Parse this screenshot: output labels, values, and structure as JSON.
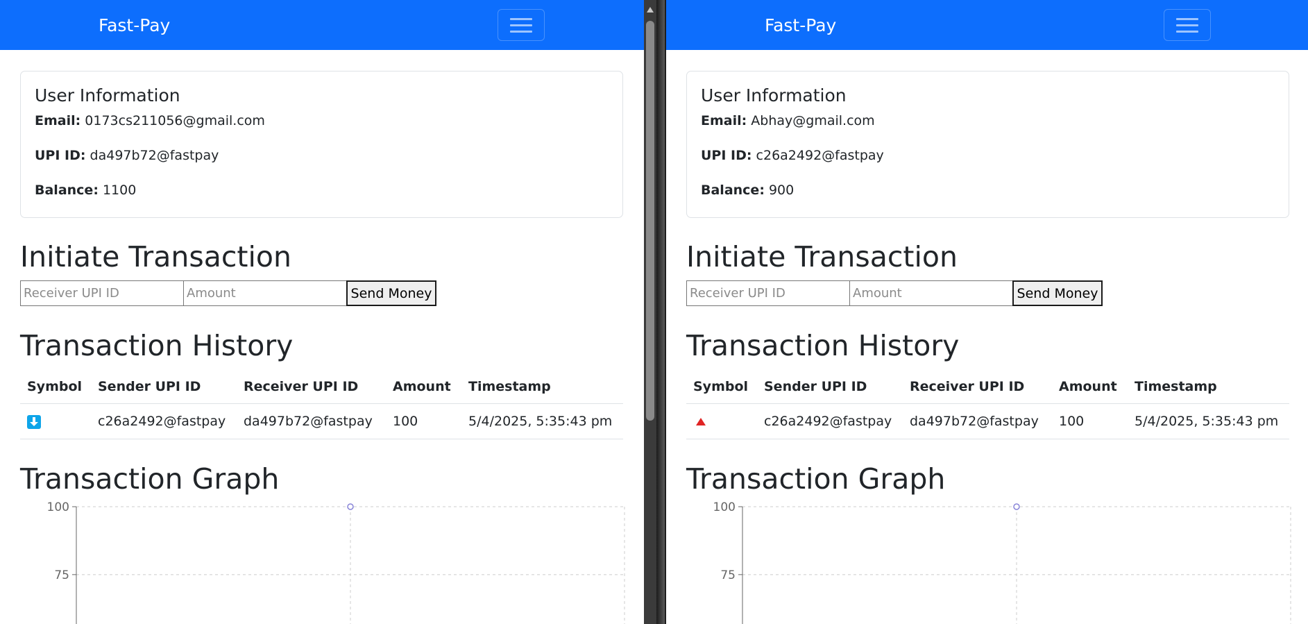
{
  "windows": [
    {
      "brand": "Fast-Pay",
      "card_title": "User Information",
      "email_label": "Email:",
      "email": "0173cs211056@gmail.com",
      "upi_label": "UPI ID:",
      "upi": "da497b72@fastpay",
      "balance_label": "Balance:",
      "balance": "1100",
      "initiate_heading": "Initiate Transaction",
      "receiver_placeholder": "Receiver UPI ID",
      "amount_placeholder": "Amount",
      "send_label": "Send Money",
      "history_heading": "Transaction History",
      "columns": [
        "Symbol",
        "Sender UPI ID",
        "Receiver UPI ID",
        "Amount",
        "Timestamp"
      ],
      "rows": [
        {
          "symbol": "received-arrow-icon",
          "sender": "c26a2492@fastpay",
          "receiver": "da497b72@fastpay",
          "amount": "100",
          "timestamp": "5/4/2025, 5:35:43 pm"
        }
      ],
      "graph_heading": "Transaction Graph",
      "chart_data": {
        "type": "line",
        "y_ticks": [
          "100",
          "75"
        ],
        "ylim_visible": [
          62,
          100
        ],
        "points": [
          {
            "x_index": 1,
            "y": 100
          }
        ],
        "x_count": 3,
        "point_color": "#8884d8",
        "grid": true
      }
    },
    {
      "brand": "Fast-Pay",
      "card_title": "User Information",
      "email_label": "Email:",
      "email": "Abhay@gmail.com",
      "upi_label": "UPI ID:",
      "upi": "c26a2492@fastpay",
      "balance_label": "Balance:",
      "balance": "900",
      "initiate_heading": "Initiate Transaction",
      "receiver_placeholder": "Receiver UPI ID",
      "amount_placeholder": "Amount",
      "send_label": "Send Money",
      "history_heading": "Transaction History",
      "columns": [
        "Symbol",
        "Sender UPI ID",
        "Receiver UPI ID",
        "Amount",
        "Timestamp"
      ],
      "rows": [
        {
          "symbol": "sent-triangle-icon",
          "sender": "c26a2492@fastpay",
          "receiver": "da497b72@fastpay",
          "amount": "100",
          "timestamp": "5/4/2025, 5:35:43 pm"
        }
      ],
      "graph_heading": "Transaction Graph",
      "chart_data": {
        "type": "line",
        "y_ticks": [
          "100",
          "75"
        ],
        "ylim_visible": [
          62,
          100
        ],
        "points": [
          {
            "x_index": 1,
            "y": 100
          }
        ],
        "x_count": 3,
        "point_color": "#8884d8",
        "grid": true
      }
    }
  ],
  "colors": {
    "navbar": "#0d6efd",
    "received_icon": "#0ea5e9",
    "sent_icon": "#e02424"
  }
}
